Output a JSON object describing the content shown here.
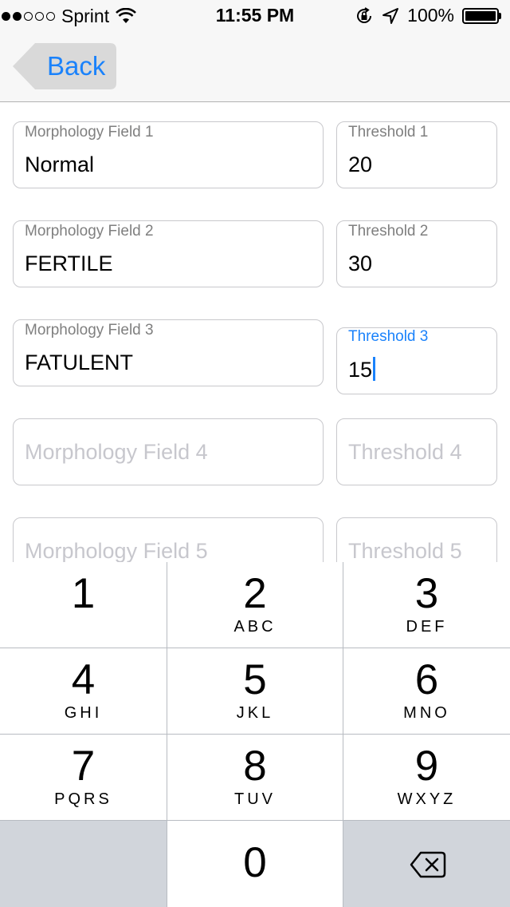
{
  "status_bar": {
    "carrier": "Sprint",
    "signal_bars_filled": 2,
    "signal_bars_total": 5,
    "time": "11:55 PM",
    "battery": "100%"
  },
  "nav": {
    "back_label": "Back"
  },
  "form": {
    "rows": [
      {
        "morph_label": "Morphology Field 1",
        "morph_value": "Normal",
        "thresh_label": "Threshold 1",
        "thresh_value": "20"
      },
      {
        "morph_label": "Morphology Field 2",
        "morph_value": "FERTILE",
        "thresh_label": "Threshold 2",
        "thresh_value": "30"
      },
      {
        "morph_label": "Morphology Field 3",
        "morph_value": "FATULENT",
        "thresh_label": "Threshold 3",
        "thresh_value": "15"
      },
      {
        "morph_placeholder": "Morphology Field 4",
        "thresh_placeholder": "Threshold 4"
      },
      {
        "morph_placeholder": "Morphology Field 5",
        "thresh_placeholder": "Threshold 5"
      }
    ]
  },
  "keypad": {
    "keys": [
      {
        "digit": "1",
        "letters": ""
      },
      {
        "digit": "2",
        "letters": "ABC"
      },
      {
        "digit": "3",
        "letters": "DEF"
      },
      {
        "digit": "4",
        "letters": "GHI"
      },
      {
        "digit": "5",
        "letters": "JKL"
      },
      {
        "digit": "6",
        "letters": "MNO"
      },
      {
        "digit": "7",
        "letters": "PQRS"
      },
      {
        "digit": "8",
        "letters": "TUV"
      },
      {
        "digit": "9",
        "letters": "WXYZ"
      },
      {
        "digit": "0",
        "letters": ""
      }
    ]
  },
  "colors": {
    "accent": "#1a82fb",
    "placeholder": "#c7c7cd",
    "key_gray": "#d1d5db"
  }
}
